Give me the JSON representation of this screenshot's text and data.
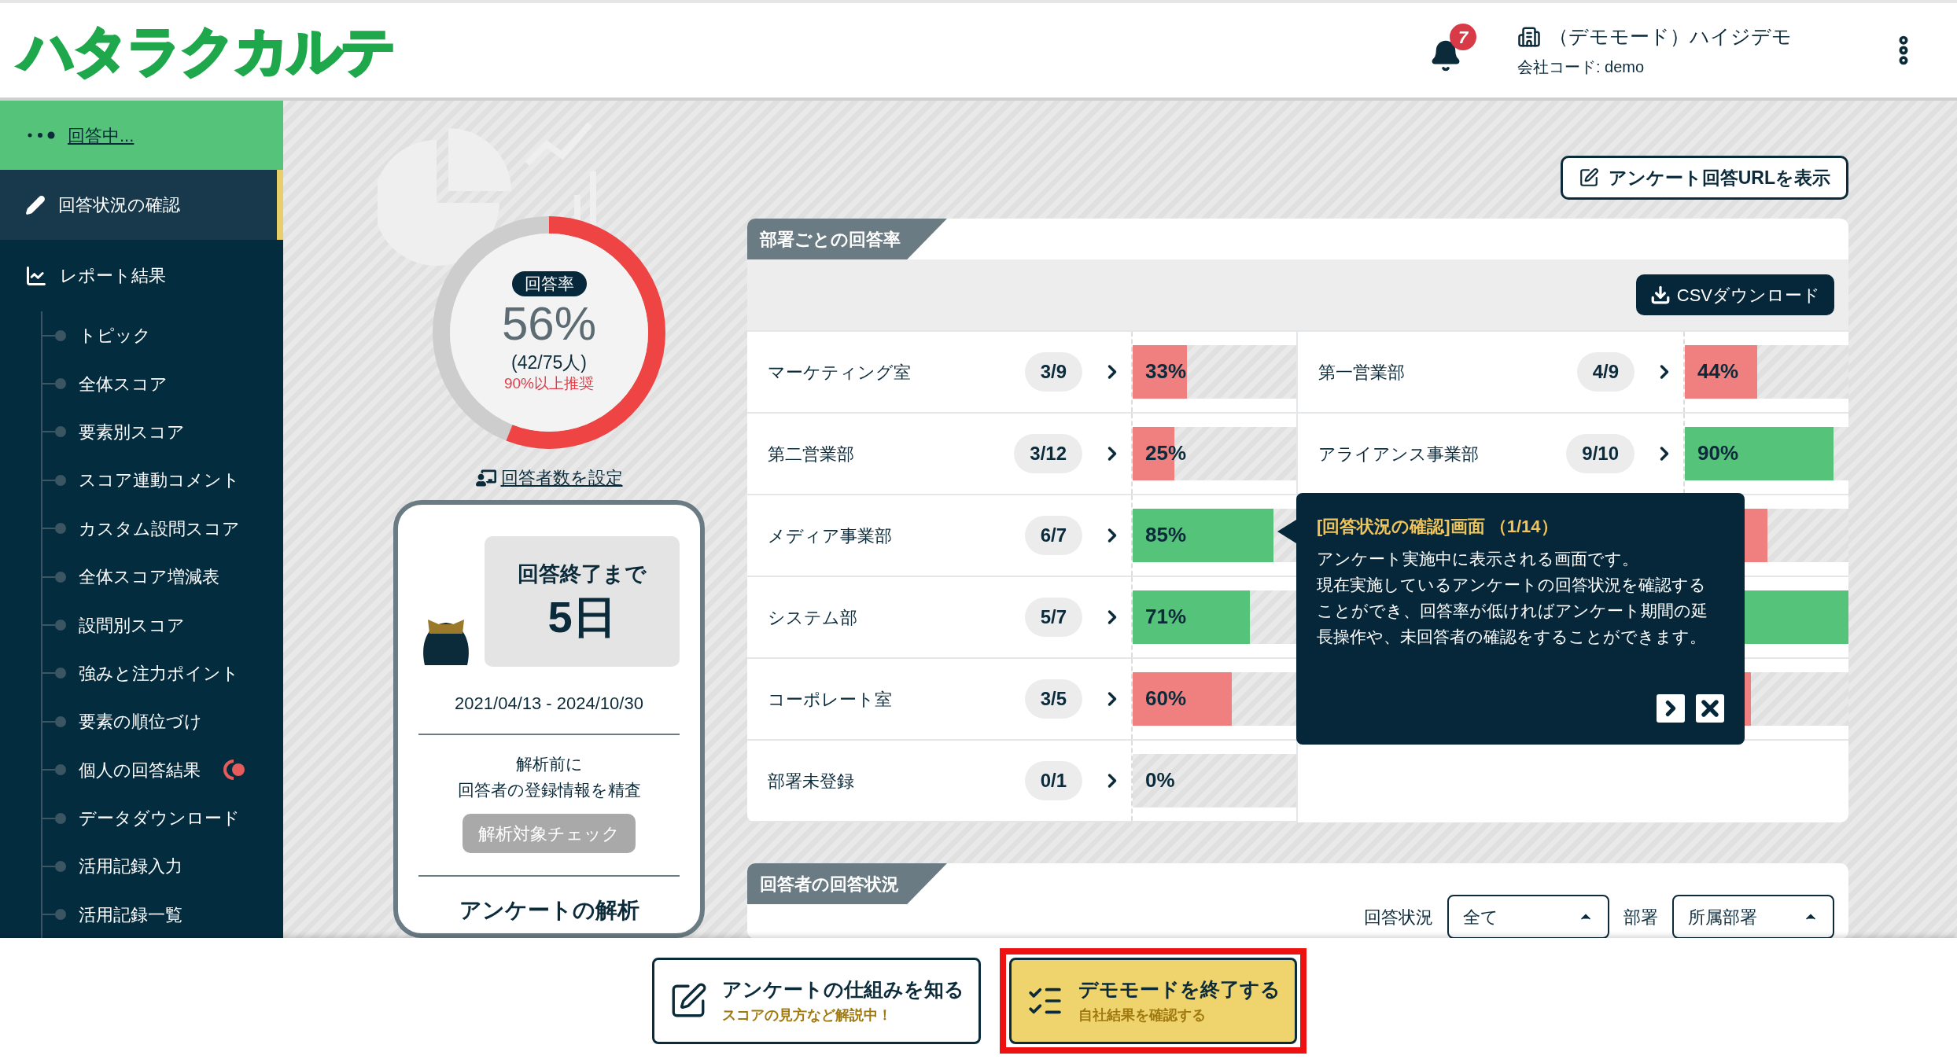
{
  "header": {
    "logo": "ハタラクカルテ",
    "notification_count": "7",
    "company_name": "（デモモード）ハイジデモ",
    "company_code": "会社コード: demo"
  },
  "sidebar": {
    "status": "回答中...",
    "items": [
      {
        "label": "回答状況の確認",
        "selected": true
      },
      {
        "label": "レポート結果",
        "selected": false,
        "children": [
          {
            "label": "トピック",
            "alert": false
          },
          {
            "label": "全体スコア",
            "alert": false
          },
          {
            "label": "要素別スコア",
            "alert": false
          },
          {
            "label": "スコア連動コメント",
            "alert": false
          },
          {
            "label": "カスタム設問スコア",
            "alert": false
          },
          {
            "label": "全体スコア増減表",
            "alert": false
          },
          {
            "label": "設問別スコア",
            "alert": false
          },
          {
            "label": "強みと注力ポイント",
            "alert": false
          },
          {
            "label": "要素の順位づけ",
            "alert": false
          },
          {
            "label": "個人の回答結果",
            "alert": true
          },
          {
            "label": "データダウンロード",
            "alert": false
          },
          {
            "label": "活用記録入力",
            "alert": false
          },
          {
            "label": "活用記録一覧",
            "alert": false
          }
        ]
      }
    ]
  },
  "response_rate": {
    "badge": "回答率",
    "percent": "56%",
    "count": "(42/75人)",
    "recommendation": "90%以上推奨",
    "level": 0.56,
    "set_link": "回答者数を設定"
  },
  "deadline_card": {
    "title": "回答終了まで",
    "days": "5日",
    "period": "2021/04/13 - 2024/10/30",
    "note": [
      "解析前に",
      "回答者の登録情報を精査"
    ],
    "check_button": {
      "label": "解析対象チェック",
      "disabled": true
    },
    "next_heading": "アンケートの解析"
  },
  "url_button": "アンケート回答URLを表示",
  "department_rates": {
    "title": "部署ごとの回答率",
    "csv_button": "CSVダウンロード",
    "departments": [
      {
        "name": "マーケティング室",
        "count": "3/9",
        "percent": "33%",
        "level": 0.33,
        "color": "#f08080"
      },
      {
        "name": "第一営業部",
        "count": "4/9",
        "percent": "44%",
        "level": 0.44,
        "color": "#f08080"
      },
      {
        "name": "第二営業部",
        "count": "3/12",
        "percent": "25%",
        "level": 0.25,
        "color": "#f08080"
      },
      {
        "name": "アライアンス事業部",
        "count": "9/10",
        "percent": "90%",
        "level": 0.9,
        "color": "#55c37a"
      },
      {
        "name": "メディア事業部",
        "count": "6/7",
        "percent": "85%",
        "level": 0.85,
        "color": "#55c37a"
      },
      {
        "level": 0.5,
        "color": "#f08080"
      },
      {
        "name": "システム部",
        "count": "5/7",
        "percent": "71%",
        "level": 0.71,
        "color": "#55c37a"
      },
      {
        "level": 1,
        "color": "#55c37a"
      },
      {
        "name": "コーポレート室",
        "count": "3/5",
        "percent": "60%",
        "level": 0.6,
        "color": "#f08080"
      },
      {
        "level": 0.4,
        "color": "#f08080"
      },
      {
        "name": "部署未登録",
        "count": "0/1",
        "percent": "0%"
      }
    ]
  },
  "tour_tooltip": {
    "title": "[回答状況の確認]画面 （1/14）",
    "body": [
      "アンケート実施中に表示される画面です。",
      "現在実施しているアンケートの回答状況を確認することができ、回答率が低ければアンケート期間の延長操作や、未回答者の確認をすることができます。"
    ]
  },
  "respondent_status": {
    "title": "回答者の回答状況",
    "filters": [
      {
        "label": "回答状況",
        "value": "全て"
      },
      {
        "label": "部署",
        "value": "所属部署"
      }
    ]
  },
  "bottom_actions": [
    {
      "title": "アンケートの仕組みを知る",
      "subtitle": "スコアの見方など解説中！",
      "highlighted": false
    },
    {
      "title": "デモモードを終了する",
      "subtitle": "自社結果を確認する",
      "highlighted": true
    }
  ]
}
